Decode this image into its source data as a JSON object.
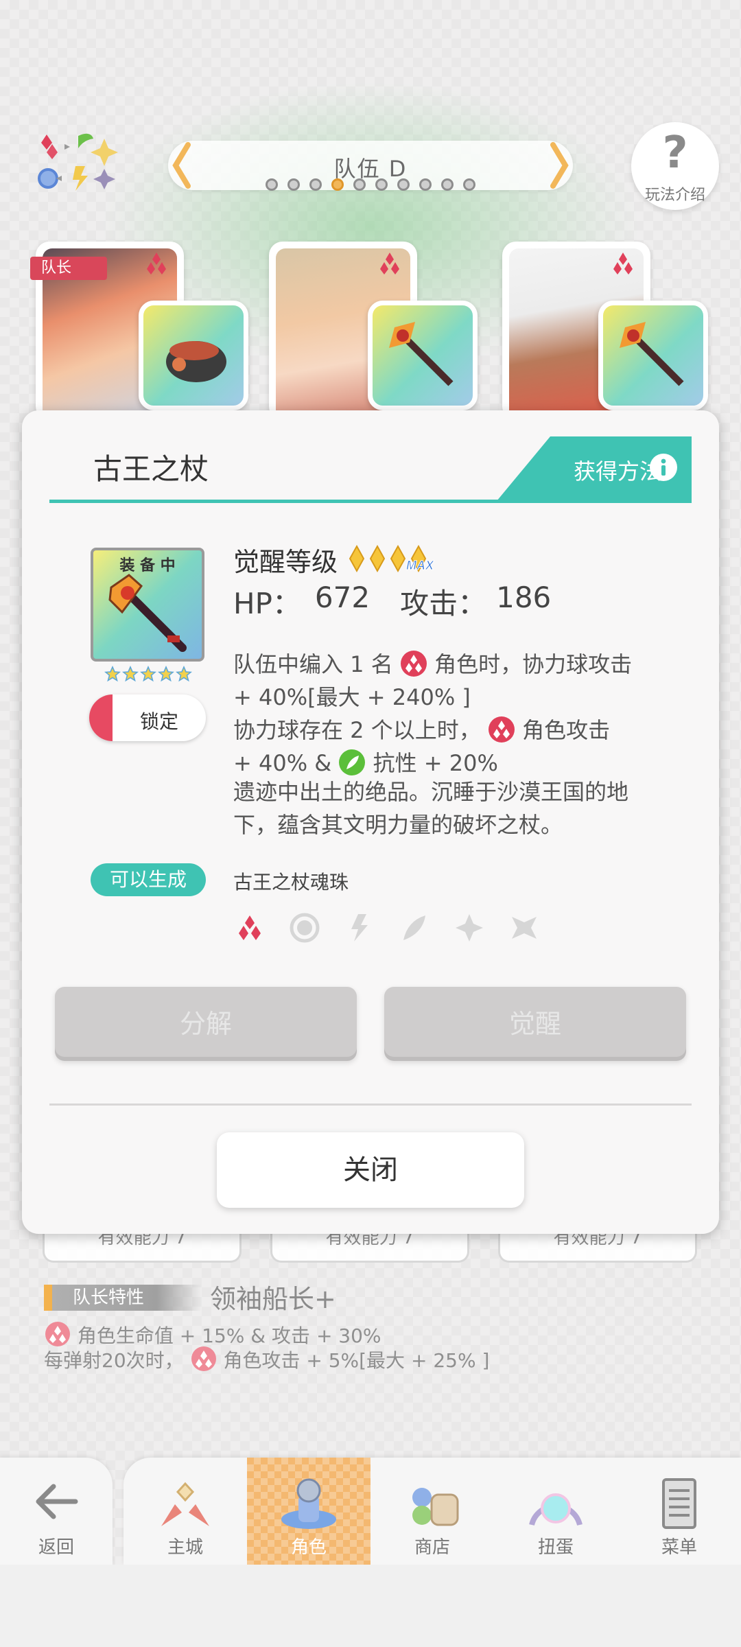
{
  "header": {
    "team_title": "队伍 D",
    "team_page_count": 10,
    "team_page_active_index": 3,
    "help_label": "玩法介绍",
    "help_glyph": "?"
  },
  "party": {
    "leader_tag": "队长"
  },
  "modal": {
    "item_name": "古王之杖",
    "obtain_label": "获得方法",
    "equipped_label": "装 备 中",
    "star_count": 5,
    "lock_label": "锁定",
    "awaken_label": "觉醒等级",
    "awaken_max_label": "MAX",
    "hp_label": "HP：",
    "hp_value": "672",
    "atk_label": "攻击：",
    "atk_value": "186",
    "skill_lines": [
      {
        "before": "队伍中编入 1 名",
        "after": "角色时，协力球攻击"
      },
      {
        "text": "+ 40%[最大 + 240% ]"
      },
      {
        "before": "协力球存在 2 个以上时，",
        "after": "角色攻击"
      },
      {
        "before": "+ 40% &",
        "after": "抗性 + 20%"
      }
    ],
    "description": [
      "遗迹中出土的绝品。沉睡于沙漠王国的地",
      "下，蕴含其文明力量的破坏之杖。"
    ],
    "craft_badge": "可以生成",
    "craft_item": "古王之杖魂珠",
    "elements": [
      "fire-icon",
      "light-icon",
      "thunder-icon",
      "wind-icon",
      "star-icon",
      "dark-icon"
    ],
    "dismantle_label": "分解",
    "awaken_button_label": "觉醒",
    "close_label": "关闭"
  },
  "leader_info": {
    "ability_pill": "有效能力 7",
    "trait_tag": "队长特性",
    "trait_name": "领袖船长+",
    "line1_text": "角色生命值 + 15% & 攻击 + 30%",
    "line2_before": "每弹射20次时，",
    "line2_after": "角色攻击 + 5%[最大 + 25% ]"
  },
  "nav": {
    "back": "返回",
    "items": [
      {
        "label": "主城",
        "icon": "castle-icon"
      },
      {
        "label": "角色",
        "icon": "character-icon",
        "active": true
      },
      {
        "label": "商店",
        "icon": "shop-icon"
      },
      {
        "label": "扭蛋",
        "icon": "gacha-icon"
      },
      {
        "label": "菜单",
        "icon": "menu-icon"
      }
    ]
  },
  "colors": {
    "accent_teal": "#3fc3b3",
    "fire_red": "#e0405a",
    "nav_active": "#f4b870"
  }
}
